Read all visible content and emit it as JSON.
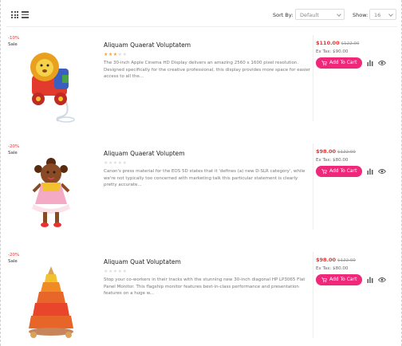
{
  "toolbar": {
    "sort_label": "Sort By:",
    "sort_value": "Default",
    "show_label": "Show:",
    "show_value": "16"
  },
  "products": [
    {
      "discount": "-10%",
      "sale": "Sale",
      "title": "Aliquam Quaerat Voluptatem",
      "rating": 3,
      "description": "The 30-inch Apple Cinema HD Display delivers an amazing 2560 x 1600 pixel resolution. Designed specifically for the creative professional, this display provides more space for easier access to all the...",
      "price": "$110.00",
      "old_price": "$122.00",
      "ex_tax": "Ex Tax: $90.00",
      "cart_label": "Add To Cart"
    },
    {
      "discount": "-20%",
      "sale": "Sale",
      "title": "Aliquam Quaerat Voluptem",
      "rating": 0,
      "description": "Canon's press material for the EOS 5D states that it 'defines (a) new D-SLR category', while we're not typically too concerned with marketing talk this particular statement is clearly pretty accurate...",
      "price": "$98.00",
      "old_price": "$122.00",
      "ex_tax": "Ex Tax: $80.00",
      "cart_label": "Add To Cart"
    },
    {
      "discount": "-20%",
      "sale": "Sale",
      "title": "Aliquam Quat Voluptatem",
      "rating": 0,
      "description": "Stop your co-workers in their tracks with the stunning new 30-inch diagonal HP LP3065 Flat Panel Monitor. This flagship monitor features best-in-class performance and presentation features on a huge w...",
      "price": "$98.00",
      "old_price": "$122.00",
      "ex_tax": "Ex Tax: $80.00",
      "cart_label": "Add To Cart"
    }
  ],
  "colors": {
    "accent": "#f0287a",
    "price": "#e8322f",
    "star_on": "#f2a63a",
    "star_off": "#dddddd"
  },
  "icons": [
    "grid-view-icon",
    "list-view-icon",
    "cart-icon",
    "compare-icon",
    "eye-icon"
  ]
}
